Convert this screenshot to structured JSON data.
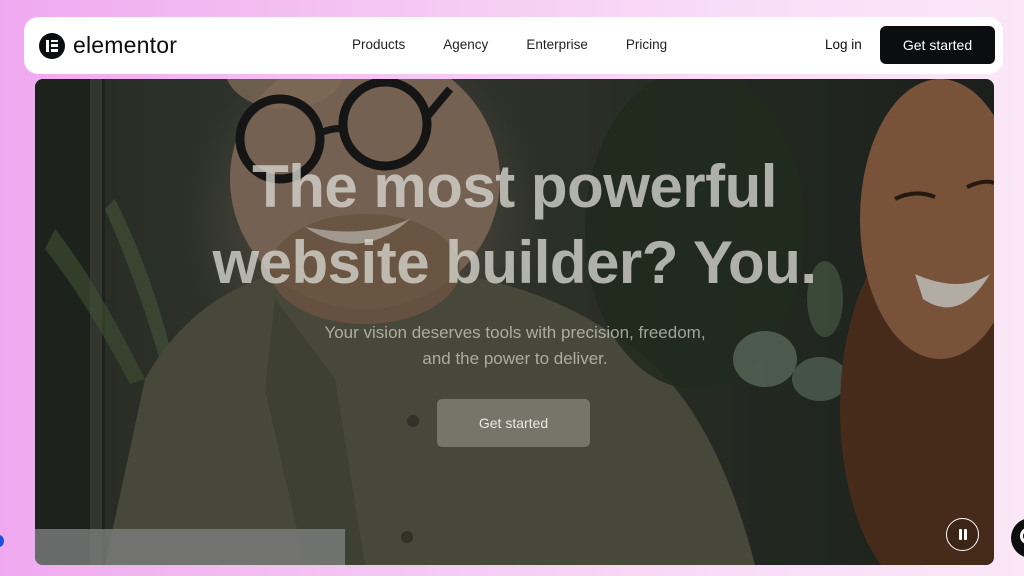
{
  "brand": {
    "name": "elementor",
    "icon": "elementor-logo-icon"
  },
  "nav": {
    "links": [
      "Products",
      "Agency",
      "Enterprise",
      "Pricing"
    ],
    "login": "Log in",
    "cta": "Get started"
  },
  "hero": {
    "title_line1": "The most powerful",
    "title_line2": "website builder? You.",
    "subtitle_line1": "Your vision deserves tools with precision, freedom,",
    "subtitle_line2": "and the power to deliver.",
    "cta": "Get started",
    "pause_icon": "pause-icon"
  },
  "colors": {
    "nav_bg": "#ffffff",
    "cta_bg": "#0c0d0e",
    "page_gradient_start": "#f0a9f0",
    "page_gradient_end": "#fbe7f8"
  }
}
